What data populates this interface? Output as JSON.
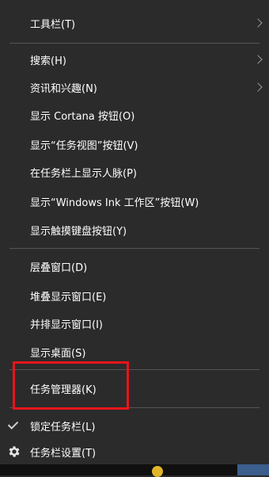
{
  "menu": {
    "items": [
      {
        "label": "工具栏(T)"
      },
      {
        "label": "搜索(H)"
      },
      {
        "label": "资讯和兴趣(N)"
      },
      {
        "label": "显示 Cortana 按钮(O)"
      },
      {
        "label": "显示“任务视图”按钮(V)"
      },
      {
        "label": "在任务栏上显示人脉(P)"
      },
      {
        "label": "显示“Windows Ink 工作区”按钮(W)"
      },
      {
        "label": "显示触摸键盘按钮(Y)"
      },
      {
        "label": "层叠窗口(D)"
      },
      {
        "label": "堆叠显示窗口(E)"
      },
      {
        "label": "并排显示窗口(I)"
      },
      {
        "label": "显示桌面(S)"
      },
      {
        "label": "任务管理器(K)"
      },
      {
        "label": "锁定任务栏(L)"
      },
      {
        "label": "任务栏设置(T)"
      }
    ]
  },
  "icons": {
    "submenu": "chevron-right-icon",
    "checked": "checkmark-icon",
    "settings": "gear-icon"
  },
  "colors": {
    "menu_background": "#2b2b2b",
    "text": "#ffffff",
    "separator": "#555555",
    "highlight_box": "#e8141a"
  }
}
